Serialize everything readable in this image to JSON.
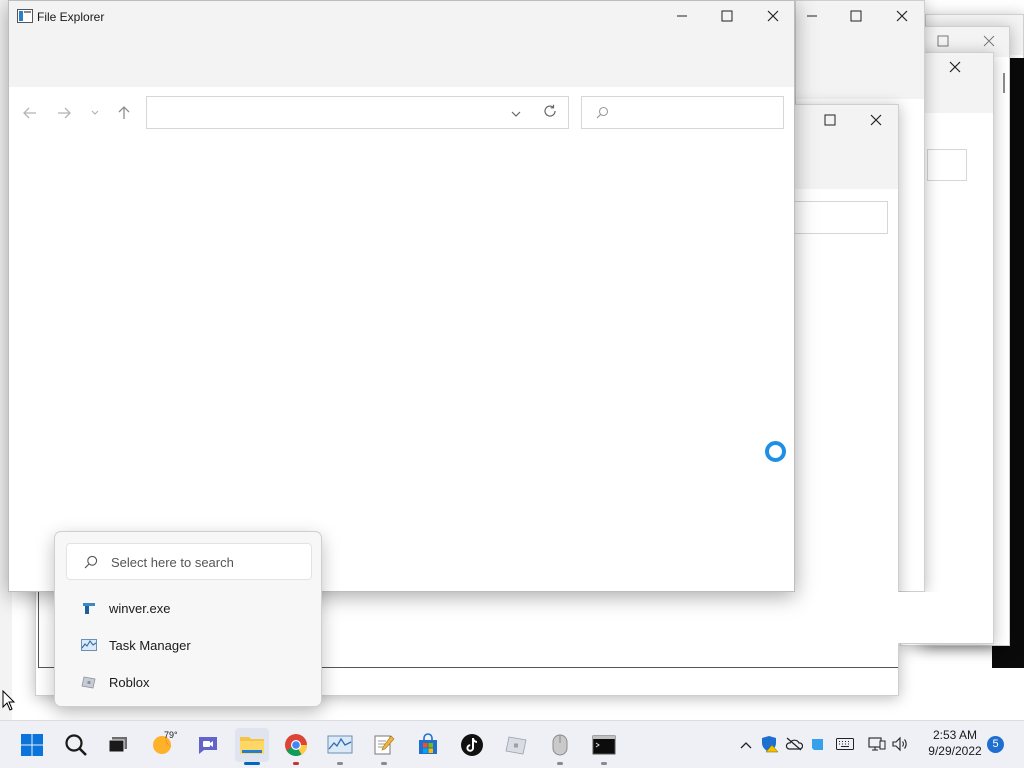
{
  "file_explorer": {
    "title": "File Explorer",
    "address_value": "",
    "search_placeholder": ""
  },
  "jumplist": {
    "search_placeholder": "Select here to search",
    "items": [
      {
        "label": "winver.exe",
        "icon": "winver-icon"
      },
      {
        "label": "Task Manager",
        "icon": "task-manager-icon"
      },
      {
        "label": "Roblox",
        "icon": "roblox-icon"
      }
    ]
  },
  "taskbar": {
    "apps": [
      {
        "name": "start",
        "icon": "windows-start-icon"
      },
      {
        "name": "search",
        "icon": "search-icon"
      },
      {
        "name": "task-view",
        "icon": "task-view-icon"
      },
      {
        "name": "weather",
        "icon": "weather-icon"
      },
      {
        "name": "chat",
        "icon": "teams-chat-icon"
      },
      {
        "name": "file-explorer",
        "icon": "folder-icon"
      },
      {
        "name": "chrome",
        "icon": "chrome-icon"
      },
      {
        "name": "task-manager",
        "icon": "task-manager-icon"
      },
      {
        "name": "notepad",
        "icon": "notepad-icon"
      },
      {
        "name": "store",
        "icon": "store-icon"
      },
      {
        "name": "tiktok",
        "icon": "tiktok-icon"
      },
      {
        "name": "roblox",
        "icon": "roblox-icon"
      },
      {
        "name": "mouse",
        "icon": "mouse-icon"
      },
      {
        "name": "terminal",
        "icon": "terminal-icon"
      }
    ],
    "weather_temp": "79°",
    "time": "2:53 AM",
    "date": "9/29/2022",
    "notification_count": "5"
  },
  "colors": {
    "accent": "#0067c0",
    "spinner": "#1f8fe6",
    "window_bg": "#f3f3f3"
  }
}
